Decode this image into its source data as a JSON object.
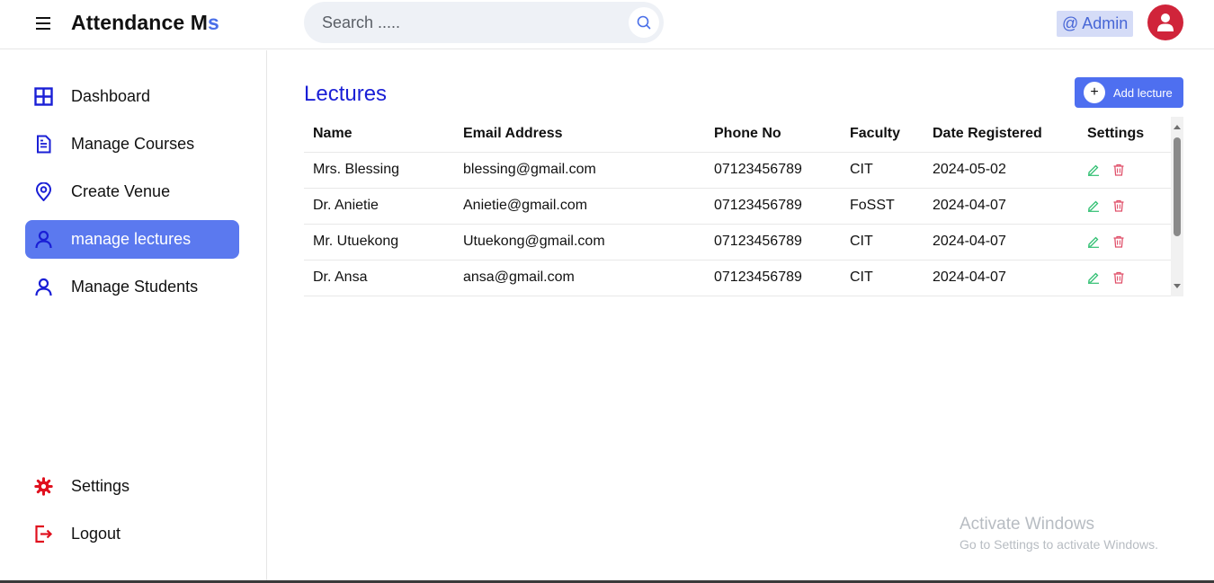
{
  "header": {
    "brand_main": "Attendance M",
    "brand_accent": "s",
    "search_placeholder": "Search .....",
    "user_badge": "@ Admin"
  },
  "sidebar": {
    "items": [
      {
        "label": "Dashboard",
        "icon": "grid-icon"
      },
      {
        "label": "Manage Courses",
        "icon": "document-icon"
      },
      {
        "label": "Create Venue",
        "icon": "location-pin-icon"
      },
      {
        "label": "manage lectures",
        "icon": "user-icon",
        "active": true
      },
      {
        "label": "Manage Students",
        "icon": "user-icon"
      }
    ],
    "bottom_items": [
      {
        "label": "Settings",
        "icon": "gear-icon"
      },
      {
        "label": "Logout",
        "icon": "logout-icon"
      }
    ]
  },
  "main": {
    "title": "Lectures",
    "add_button": "Add lecture",
    "add_button_icon": "+",
    "table": {
      "columns": [
        "Name",
        "Email Address",
        "Phone No",
        "Faculty",
        "Date Registered",
        "Settings"
      ],
      "rows": [
        {
          "name": "Mrs. Blessing",
          "email": "blessing@gmail.com",
          "phone": "07123456789",
          "faculty": "CIT",
          "date": "2024-05-02"
        },
        {
          "name": "Dr. Anietie",
          "email": "Anietie@gmail.com",
          "phone": "07123456789",
          "faculty": "FoSST",
          "date": "2024-04-07"
        },
        {
          "name": "Mr. Utuekong",
          "email": "Utuekong@gmail.com",
          "phone": "07123456789",
          "faculty": "CIT",
          "date": "2024-04-07"
        },
        {
          "name": "Dr. Ansa",
          "email": "ansa@gmail.com",
          "phone": "07123456789",
          "faculty": "CIT",
          "date": "2024-04-07"
        }
      ]
    }
  },
  "watermark": {
    "line1": "Activate Windows",
    "line2": "Go to Settings to activate Windows."
  },
  "colors": {
    "accent": "#5b79ef",
    "title": "#1a1fd6",
    "edit": "#2fbf71",
    "delete": "#e0506a",
    "danger_icon": "#e0101e"
  }
}
